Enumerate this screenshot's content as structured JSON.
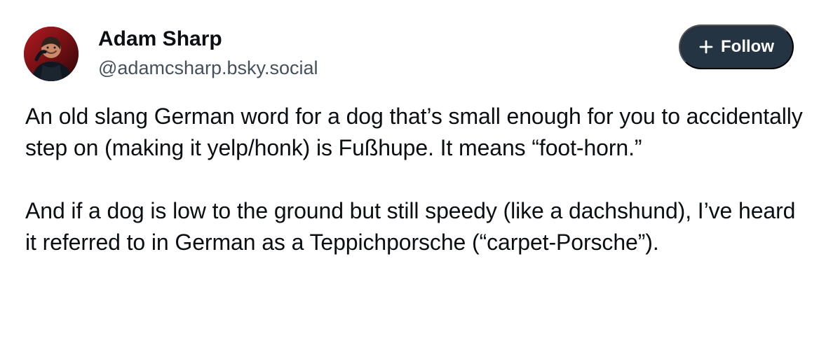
{
  "author": {
    "display_name": "Adam Sharp",
    "handle": "@adamcsharp.bsky.social",
    "avatar_icon": "profile-photo"
  },
  "actions": {
    "follow_icon": "plus-icon",
    "follow_label": "Follow"
  },
  "post": {
    "paragraphs": [
      "An old slang German word for a dog that’s small enough for you to accidentally step on (making it yelp/honk) is Fußhupe. It means “foot-horn.”",
      "And if a dog is low to the ground but still speedy (like a dachshund), I’ve heard it referred to in German as a Teppichporsche (“carpet-Porsche”)."
    ]
  },
  "colors": {
    "background": "#ffffff",
    "text": "#0b0f14",
    "handle": "#46505c",
    "follow_button": "#243442",
    "follow_text": "#ffffff"
  }
}
